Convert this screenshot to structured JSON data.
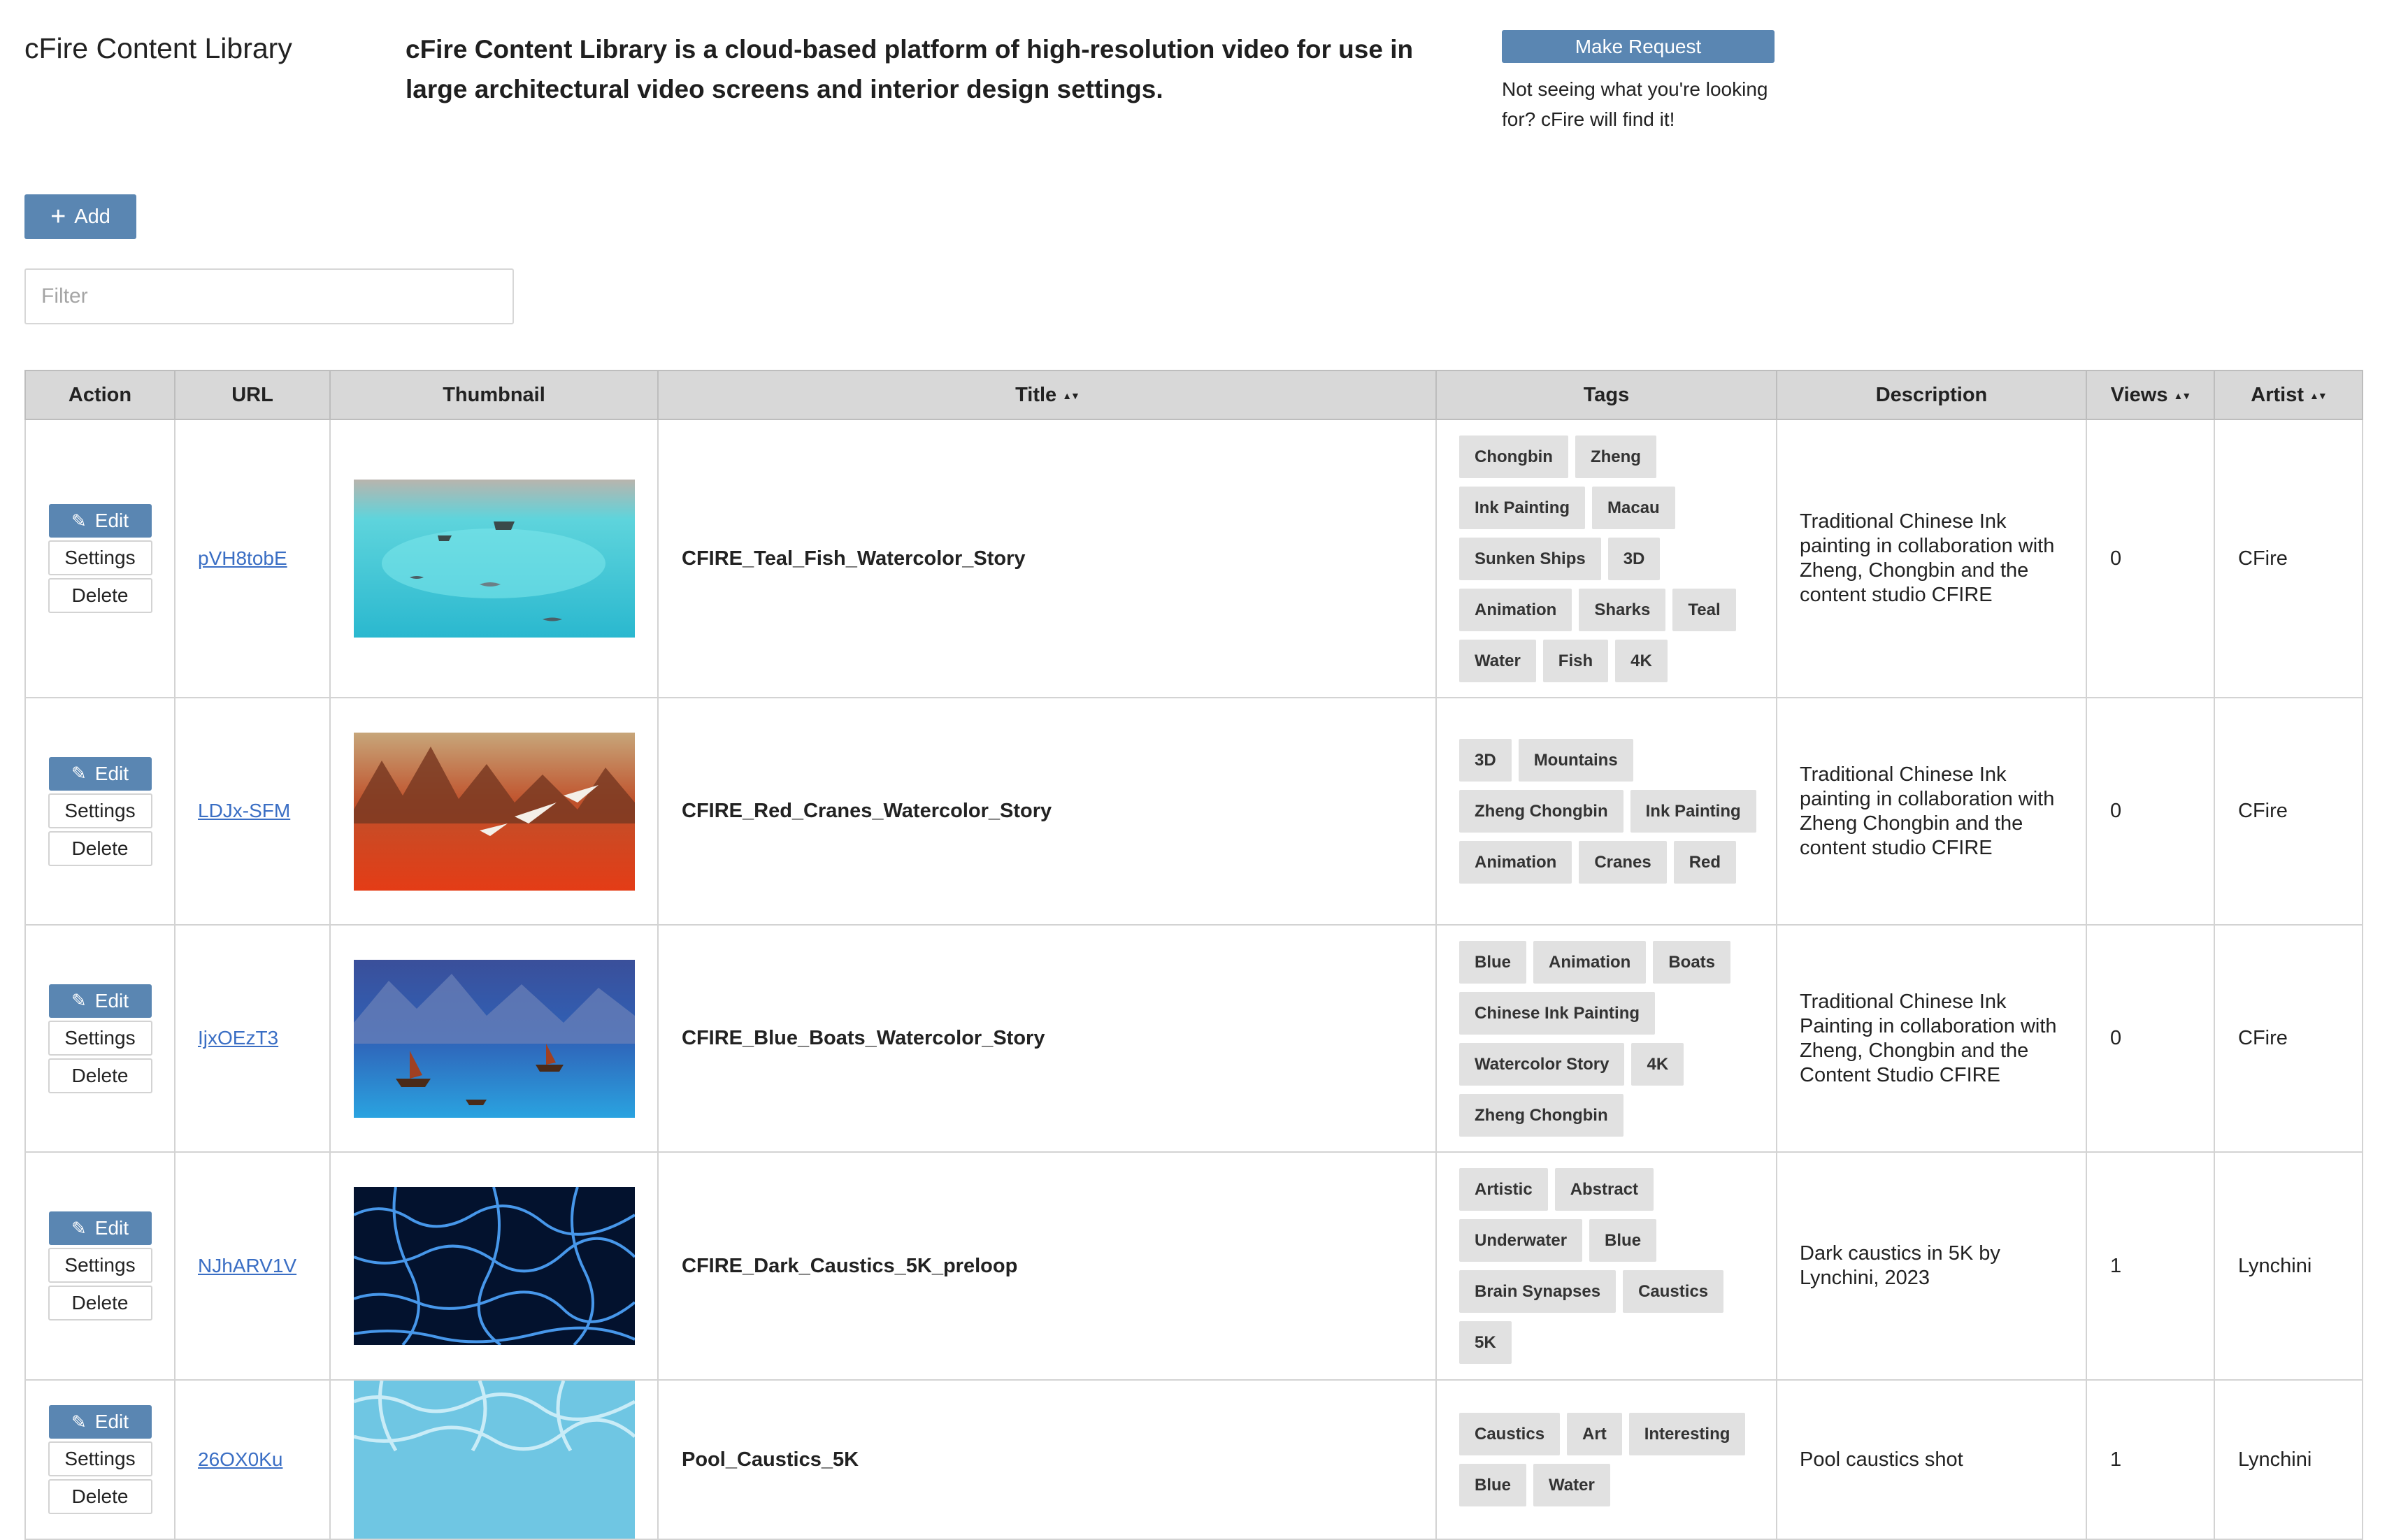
{
  "header": {
    "app_title": "cFire Content Library",
    "tagline": "cFire Content Library is a cloud-based platform of high-resolution video for use in large architectural video screens and interior design settings.",
    "request_button": "Make Request",
    "request_hint": "Not seeing what you're looking for? cFire will find it!"
  },
  "toolbar": {
    "add_label": "Add",
    "filter_placeholder": "Filter"
  },
  "colors": {
    "primary_button": "#5a86b2",
    "header_bg": "#d8d8d8",
    "tag_bg": "#e1e1e1",
    "link": "#3a6ec4"
  },
  "table": {
    "columns": [
      "Action",
      "URL",
      "Thumbnail",
      "Title",
      "Tags",
      "Description",
      "Views",
      "Artist"
    ],
    "sortable_columns": [
      "Title",
      "Views",
      "Artist"
    ],
    "action_labels": {
      "edit": "Edit",
      "settings": "Settings",
      "delete": "Delete"
    },
    "rows": [
      {
        "url": "pVH8tobE",
        "thumbnail": "teal-fish-watercolor",
        "title": "CFIRE_Teal_Fish_Watercolor_Story",
        "tags": [
          "Chongbin",
          "Zheng",
          "Ink Painting",
          "Macau",
          "Sunken Ships",
          "3D",
          "Animation",
          "Sharks",
          "Teal",
          "Water",
          "Fish",
          "4K"
        ],
        "description": "Traditional Chinese Ink painting in collaboration with Zheng, Chongbin and the content studio CFIRE",
        "views": "0",
        "artist": "CFire"
      },
      {
        "url": "LDJx-SFM",
        "thumbnail": "red-cranes-watercolor",
        "title": "CFIRE_Red_Cranes_Watercolor_Story",
        "tags": [
          "3D",
          "Mountains",
          "Zheng Chongbin",
          "Ink Painting",
          "Animation",
          "Cranes",
          "Red"
        ],
        "description": "Traditional Chinese Ink painting in collaboration with Zheng Chongbin and the content studio CFIRE",
        "views": "0",
        "artist": "CFire"
      },
      {
        "url": "IjxOEzT3",
        "thumbnail": "blue-boats-watercolor",
        "title": "CFIRE_Blue_Boats_Watercolor_Story",
        "tags": [
          "Blue",
          "Animation",
          "Boats",
          "Chinese Ink Painting",
          "Watercolor Story",
          "4K",
          "Zheng Chongbin"
        ],
        "description": "Traditional Chinese Ink Painting in collaboration with Zheng, Chongbin and the Content Studio CFIRE",
        "views": "0",
        "artist": "CFire"
      },
      {
        "url": "NJhARV1V",
        "thumbnail": "dark-caustics",
        "title": "CFIRE_Dark_Caustics_5K_preloop",
        "tags": [
          "Artistic",
          "Abstract",
          "Underwater",
          "Blue",
          "Brain Synapses",
          "Caustics",
          "5K"
        ],
        "description": "Dark caustics in 5K by Lynchini, 2023",
        "views": "1",
        "artist": "Lynchini"
      },
      {
        "url": "26OX0Ku",
        "thumbnail": "pool-caustics",
        "title": "Pool_Caustics_5K",
        "tags": [
          "Caustics",
          "Art",
          "Interesting",
          "Blue",
          "Water"
        ],
        "description": "Pool caustics shot",
        "views": "1",
        "artist": "Lynchini"
      }
    ]
  }
}
